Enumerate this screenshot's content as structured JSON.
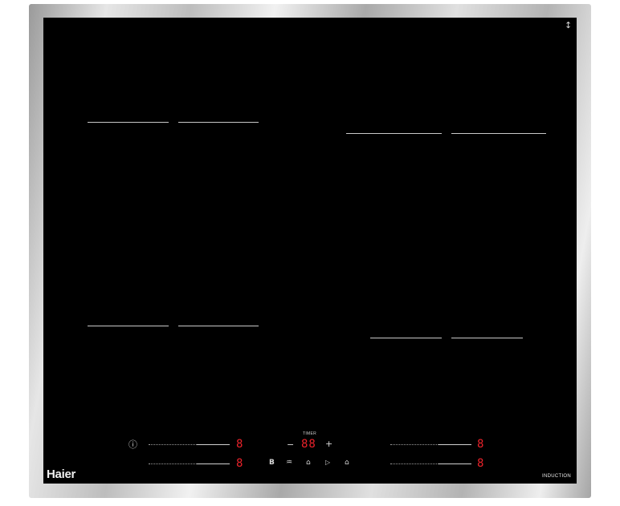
{
  "brand": "Haier",
  "badge": "INDUCTION",
  "timer": {
    "label": "TIMER",
    "minus": "−",
    "display": "88",
    "plus": "+"
  },
  "zones": [
    {
      "display": "8"
    },
    {
      "display": "8"
    },
    {
      "display": "8"
    },
    {
      "display": "8"
    }
  ],
  "controls": {
    "info_icon": "ⓘ",
    "boost_icon": "B",
    "keep_warm_icon": "♒",
    "flex_icon": "⌂",
    "pause_icon": "▷",
    "lock_icon": "⌂",
    "top_right_icon": "↕"
  },
  "colors": {
    "display": "#e8222a",
    "glass": "#000000",
    "frame": "#c8c8c8"
  }
}
